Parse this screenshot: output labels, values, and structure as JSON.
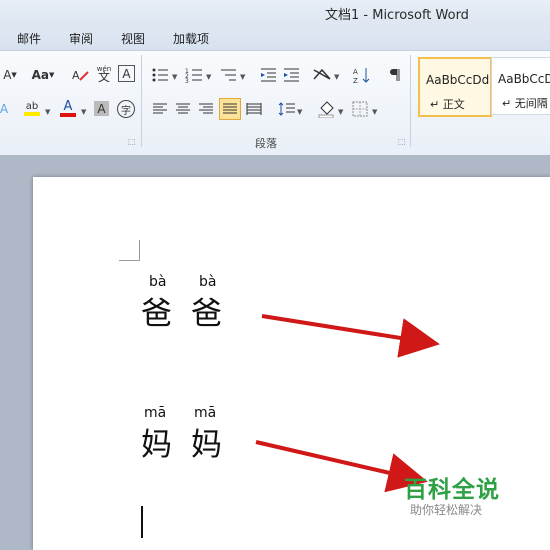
{
  "window": {
    "title": "文档1 - Microsoft Word"
  },
  "tabs": [
    {
      "label": "邮件"
    },
    {
      "label": "审阅"
    },
    {
      "label": "视图"
    },
    {
      "label": "加载项"
    }
  ],
  "ribbon": {
    "font_icons": {
      "font_size_label": "A",
      "case_label": "Aa",
      "highlight_label": "ab",
      "font_color_label": "A",
      "char_shading_label": "A",
      "enclose_label": "字",
      "phonetic_label": "wén",
      "phonetic_char": "文",
      "border_label": "A"
    },
    "paragraph_group_label": "段落",
    "styles": [
      {
        "sample": "AaBbCcDd",
        "name": "↵ 正文",
        "selected": true
      },
      {
        "sample": "AaBbCcDd",
        "name": "↵ 无间隔",
        "selected": false
      }
    ]
  },
  "document": {
    "lines": [
      {
        "chars": [
          {
            "pinyin": "bà",
            "hanzi": "爸"
          },
          {
            "pinyin": "bà",
            "hanzi": "爸"
          }
        ]
      },
      {
        "chars": [
          {
            "pinyin": "mā",
            "hanzi": "妈"
          },
          {
            "pinyin": "mā",
            "hanzi": "妈"
          }
        ]
      }
    ]
  },
  "watermark": {
    "title": "百科全说",
    "subtitle": "助你轻松解决"
  },
  "colors": {
    "arrow": "#d01818",
    "watermark_green": "#2fa145",
    "selected_style_border": "#f3c04d"
  }
}
